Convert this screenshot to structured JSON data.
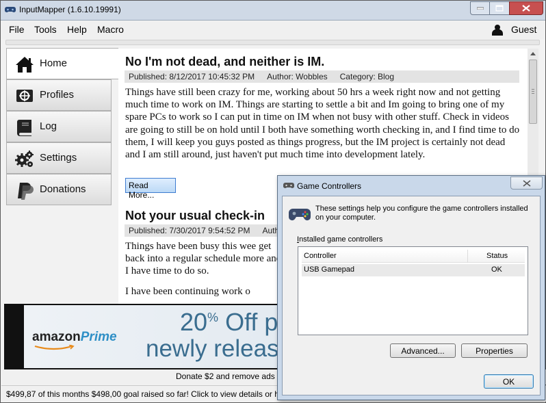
{
  "window": {
    "title": "InputMapper (1.6.10.19991)"
  },
  "menu": {
    "items": [
      "File",
      "Tools",
      "Help",
      "Macro"
    ],
    "user_label": "Guest"
  },
  "sidebar": {
    "items": [
      {
        "label": "Home",
        "icon": "home-icon",
        "active": true
      },
      {
        "label": "Profiles",
        "icon": "crosshair-icon",
        "active": false
      },
      {
        "label": "Log",
        "icon": "book-icon",
        "active": false
      },
      {
        "label": "Settings",
        "icon": "gears-icon",
        "active": false
      },
      {
        "label": "Donations",
        "icon": "paypal-icon",
        "active": false
      }
    ]
  },
  "posts": [
    {
      "title": "No I'm not dead, and neither is IM.",
      "published": "Published: 8/12/2017 10:45:32 PM",
      "author": "Author: Wobbles",
      "category": "Category: Blog",
      "body": "Things have still been crazy for me, working about 50 hrs a week right now and not getting much time to work on IM. Things are starting to settle a bit and Im going to bring one of my spare PCs to work so I can put in time on IM when not busy with other stuff. Check in videos are going to still be on hold until I both have something worth checking in, and I find time to do them, I will keep you guys posted as things progress, but the IM project is certainly not dead and I am still around, just haven't put much time into development lately.",
      "read_more": "Read More..."
    },
    {
      "title": "Not your usual check-in",
      "published": "Published: 7/30/2017 9:54:52 PM",
      "author": "Autho",
      "body1": "Things have been busy this wee get back into a regular schedule more and I have time to do so.",
      "body2": "I have been continuing work o"
    }
  ],
  "ad": {
    "brand": "amazon",
    "brand_accent": "Prime",
    "percent": "20",
    "percent_sign": "%",
    "line1_rest": "Off p",
    "line2": "newly release"
  },
  "donate_text": "Donate $2 and remove ads f",
  "status_text": "$499,87 of this months $498,00 goal raised so far!  Click to view details or h",
  "dialog": {
    "title": "Game Controllers",
    "description": "These settings help you configure the game controllers installed on your computer.",
    "group_label_first": "I",
    "group_label_rest": "nstalled game controllers",
    "columns": [
      "Controller",
      "Status"
    ],
    "rows": [
      {
        "controller": "USB Gamepad",
        "status": "OK"
      }
    ],
    "advanced_button": "Advanced...",
    "properties_button": "Properties",
    "ok_button": "OK"
  },
  "colors": {
    "titlebar": "#cfd9e6",
    "close_red": "#c75050",
    "prime_blue": "#2e8fc6",
    "ad_text": "#3a6d8f",
    "dialog_frame": "#c9d8ea"
  }
}
